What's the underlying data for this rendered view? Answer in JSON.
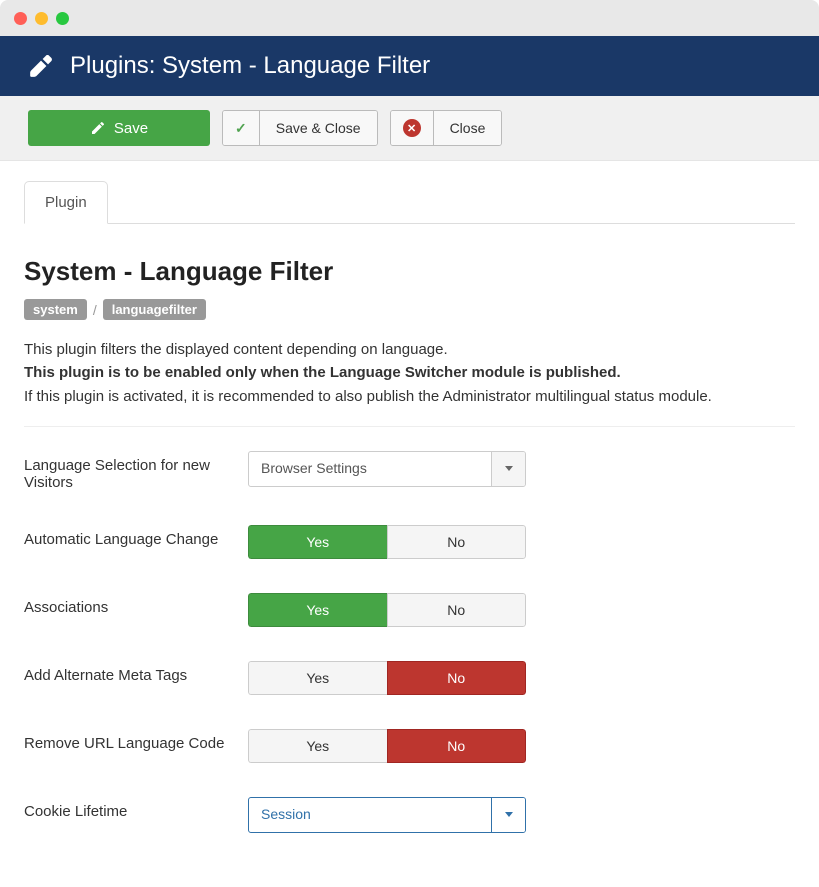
{
  "header": {
    "title": "Plugins: System - Language Filter"
  },
  "toolbar": {
    "save": "Save",
    "save_close": "Save & Close",
    "close": "Close"
  },
  "tabs": {
    "plugin": "Plugin"
  },
  "page": {
    "title": "System - Language Filter",
    "badge1": "system",
    "badge_sep": "/",
    "badge2": "languagefilter",
    "desc_line1": "This plugin filters the displayed content depending on language.",
    "desc_line2": "This plugin is to be enabled only when the Language Switcher module is published.",
    "desc_line3": "If this plugin is activated, it is recommended to also publish the Administrator multilingual status module."
  },
  "fields": {
    "lang_selection": {
      "label": "Language Selection for new Visitors",
      "value": "Browser Settings"
    },
    "auto_change": {
      "label": "Automatic Language Change",
      "yes": "Yes",
      "no": "No",
      "selected": "yes"
    },
    "associations": {
      "label": "Associations",
      "yes": "Yes",
      "no": "No",
      "selected": "yes"
    },
    "alt_meta": {
      "label": "Add Alternate Meta Tags",
      "yes": "Yes",
      "no": "No",
      "selected": "no"
    },
    "remove_url": {
      "label": "Remove URL Language Code",
      "yes": "Yes",
      "no": "No",
      "selected": "no"
    },
    "cookie": {
      "label": "Cookie Lifetime",
      "value": "Session"
    }
  }
}
